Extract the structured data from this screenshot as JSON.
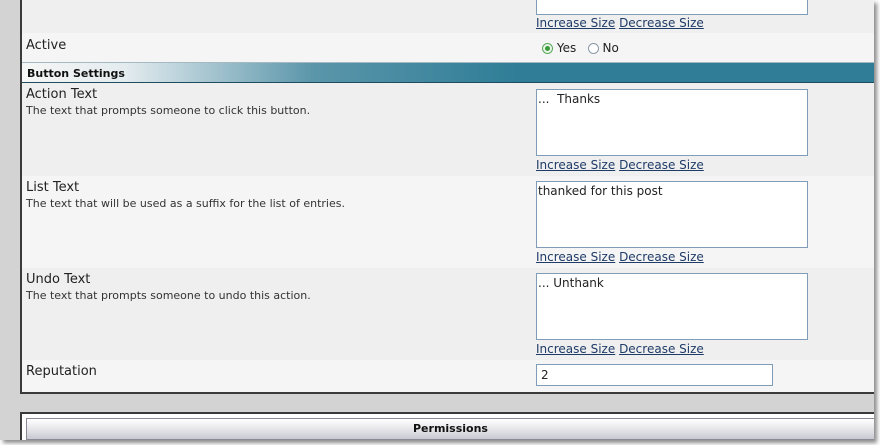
{
  "links": {
    "increase_size": "Increase Size",
    "decrease_size": "Decrease Size"
  },
  "active": {
    "label": "Active",
    "yes_label": "Yes",
    "no_label": "No",
    "selected": "Yes"
  },
  "section": {
    "title": "Button Settings"
  },
  "action_text": {
    "label": "Action Text",
    "description": "The text that prompts someone to click this button.",
    "value": "...  Thanks"
  },
  "list_text": {
    "label": "List Text",
    "description": "The text that will be used as a suffix for the list of entries.",
    "value": "thanked for this post"
  },
  "undo_text": {
    "label": "Undo Text",
    "description": "The text that prompts someone to undo this action.",
    "value": "... Unthank"
  },
  "reputation": {
    "label": "Reputation",
    "value": "2"
  },
  "permissions": {
    "title": "Permissions"
  },
  "colors": {
    "header_teal": "#2f7d97",
    "link": "#1f3b67",
    "input_border": "#7f9db9",
    "radio_checked": "#3a9b3a"
  }
}
